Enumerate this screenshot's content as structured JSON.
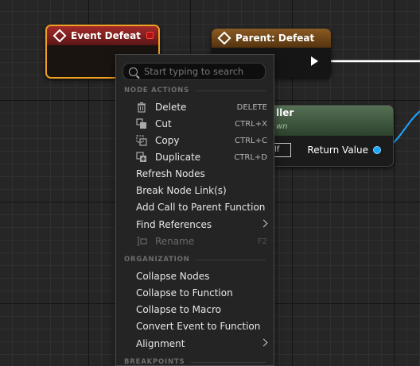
{
  "nodes": {
    "event": {
      "title": "Event Defeat"
    },
    "parent": {
      "title": "Parent: Defeat"
    },
    "pure": {
      "title": "ller",
      "subtitle": "wn",
      "self_pin": "lf",
      "return_label": "Return Value"
    }
  },
  "menu": {
    "search": {
      "placeholder": "Start typing to search",
      "value": ""
    },
    "sections": {
      "node_actions": "NODE ACTIONS",
      "organization": "ORGANIZATION",
      "breakpoints": "BREAKPOINTS"
    },
    "items": [
      {
        "label": "Delete",
        "shortcut": "DELETE",
        "icon": "trash-icon"
      },
      {
        "label": "Cut",
        "shortcut": "CTRL+X",
        "icon": "cut-icon"
      },
      {
        "label": "Copy",
        "shortcut": "CTRL+C",
        "icon": "copy-icon"
      },
      {
        "label": "Duplicate",
        "shortcut": "CTRL+D",
        "icon": "duplicate-icon"
      },
      {
        "label": "Refresh Nodes"
      },
      {
        "label": "Break Node Link(s)"
      },
      {
        "label": "Add Call to Parent Function"
      },
      {
        "label": "Find References",
        "submenu": true
      },
      {
        "label": "Rename",
        "shortcut": "F2",
        "icon": "rename-icon",
        "disabled": true
      },
      {
        "label": "Collapse Nodes"
      },
      {
        "label": "Collapse to Function"
      },
      {
        "label": "Collapse to Macro"
      },
      {
        "label": "Convert Event to Function"
      },
      {
        "label": "Alignment",
        "submenu": true
      }
    ]
  },
  "colors": {
    "event_header": "#a42a2a",
    "parent_header": "#8a5a22",
    "pure_header": "#557055",
    "data_pin": "#1aa7ff",
    "selection": "#f0a020"
  }
}
